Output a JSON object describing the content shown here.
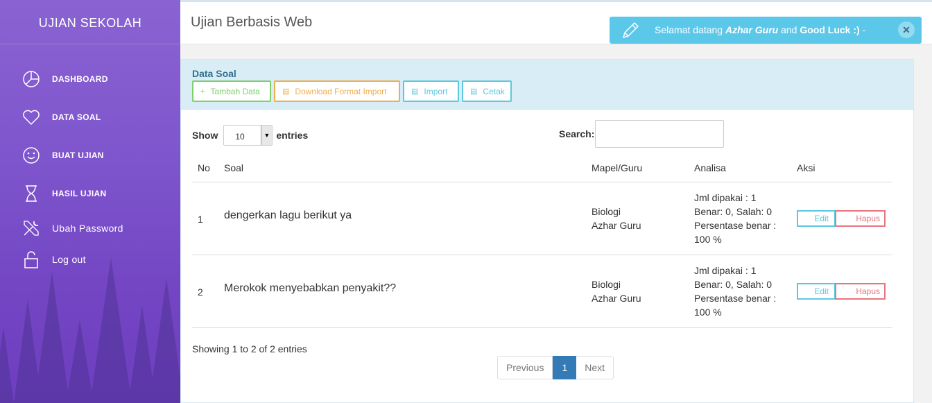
{
  "sidebar": {
    "brand": "UJIAN SEKOLAH",
    "items": [
      {
        "label": "DASHBOARD",
        "icon": "pie-chart-icon"
      },
      {
        "label": "DATA SOAL",
        "icon": "heart-icon"
      },
      {
        "label": "BUAT UJIAN",
        "icon": "smile-icon"
      },
      {
        "label": "HASIL UJIAN",
        "icon": "hourglass-icon"
      },
      {
        "label": "Ubah Password",
        "icon": "tools-icon"
      },
      {
        "label": "Log out",
        "icon": "unlock-icon"
      }
    ]
  },
  "header": {
    "title": "Ujian Berbasis Web",
    "toast": {
      "prefix": "Selamat datang ",
      "user": "Azhar Guru",
      "middle": " and ",
      "luck": "Good Luck :)",
      "suffix": " -",
      "close": "✕"
    }
  },
  "panel": {
    "title": "Data Soal",
    "buttons": {
      "add": "Tambah Data",
      "download": "Download Format Import",
      "import": "Import",
      "print": "Cetak"
    },
    "show_label": "Show",
    "entries_label": "entries",
    "page_length": "10",
    "search_label": "Search:",
    "search_value": ""
  },
  "table": {
    "headers": {
      "no": "No",
      "soal": "Soal",
      "mapel": "Mapel/Guru",
      "analisa": "Analisa",
      "aksi": "Aksi"
    },
    "rows": [
      {
        "no": "1",
        "soal": "dengerkan lagu berikut ya",
        "mapel": "Biologi",
        "guru": "Azhar Guru",
        "ana1": "Jml dipakai : 1",
        "ana2": "Benar: 0, Salah: 0",
        "ana3": "Persentase benar :",
        "ana4": "100 %",
        "edit": "Edit",
        "hapus": "Hapus"
      },
      {
        "no": "2",
        "soal": "Merokok menyebabkan penyakit??",
        "mapel": "Biologi",
        "guru": "Azhar Guru",
        "ana1": "Jml dipakai : 1",
        "ana2": "Benar: 0, Salah: 0",
        "ana3": "Persentase benar :",
        "ana4": "100 %",
        "edit": "Edit",
        "hapus": "Hapus"
      }
    ]
  },
  "footer": {
    "info": "Showing 1 to 2 of 2 entries",
    "prev": "Previous",
    "page": "1",
    "next": "Next"
  },
  "colors": {
    "sidebar": "#7e55cc",
    "toast": "#5bc8ea",
    "panel_head": "#d9edf7",
    "primary": "#337ab7"
  }
}
